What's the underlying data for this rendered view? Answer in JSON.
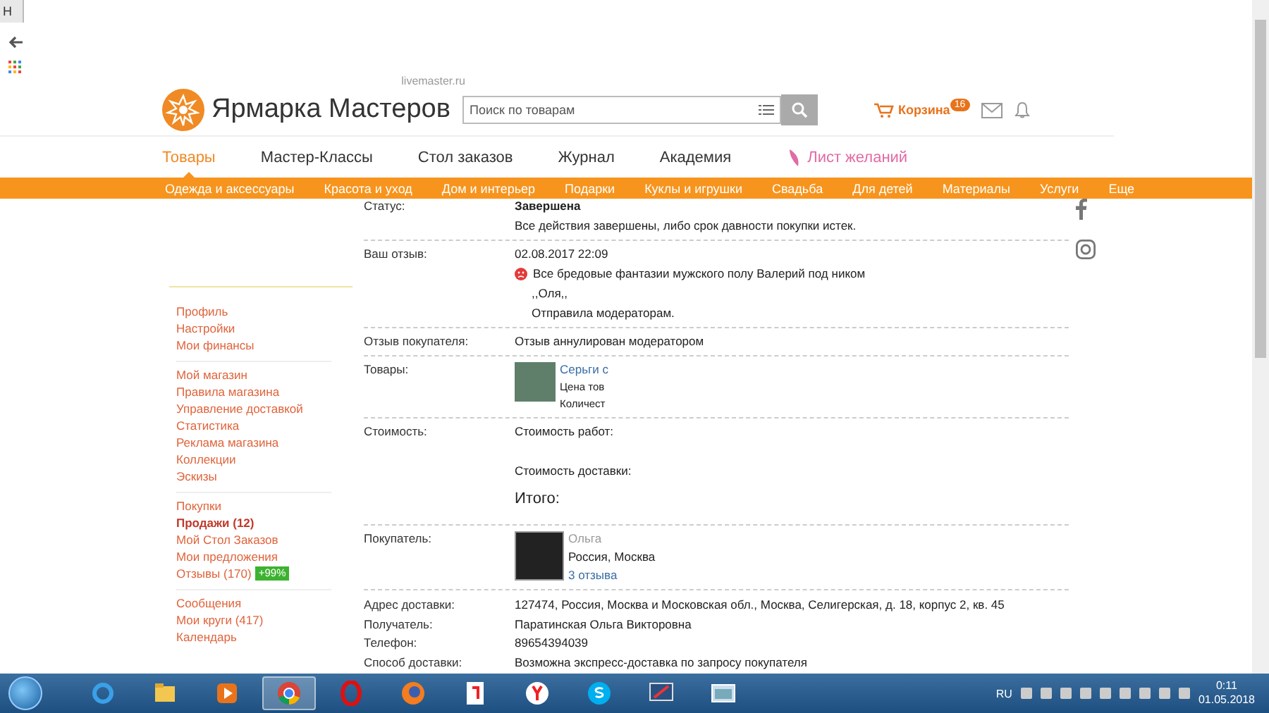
{
  "browser": {
    "tab_title": "Н"
  },
  "header": {
    "logo_text": "Ярмарка Мастеров",
    "logo_domain": "livemaster.ru",
    "search": {
      "placeholder": "Поиск по товарам"
    },
    "cart": {
      "label": "Корзина",
      "count": "16"
    }
  },
  "main_nav": [
    {
      "kind": "tab",
      "label": "Товары",
      "selected": true
    },
    {
      "kind": "tab",
      "label": "Мастер-Классы",
      "selected": false
    },
    {
      "kind": "tab",
      "label": "Стол заказов",
      "selected": false
    },
    {
      "kind": "tab",
      "label": "Журнал",
      "selected": false
    },
    {
      "kind": "tab",
      "label": "Академия",
      "selected": false
    },
    {
      "kind": "wishlist",
      "label": "Лист желаний",
      "selected": false
    }
  ],
  "categories": [
    "Одежда и аксессуары",
    "Красота и уход",
    "Дом и интерьер",
    "Подарки",
    "Куклы и игрушки",
    "Свадьба",
    "Для детей",
    "Материалы",
    "Услуги",
    "Еще"
  ],
  "sidebar": {
    "groups": [
      [
        {
          "label": "Профиль",
          "selected": false
        },
        {
          "label": "Настройки",
          "selected": false
        },
        {
          "label": "Мои финансы",
          "selected": false
        }
      ],
      [
        {
          "label": "Мой магазин",
          "selected": false
        },
        {
          "label": "Правила магазина",
          "selected": false
        },
        {
          "label": "Управление доставкой",
          "selected": false
        },
        {
          "label": "Статистика",
          "selected": false
        },
        {
          "label": "Реклама магазина",
          "selected": false
        },
        {
          "label": "Коллекции",
          "selected": false
        },
        {
          "label": "Эскизы",
          "selected": false
        }
      ],
      [
        {
          "label": "Покупки",
          "selected": false
        },
        {
          "label": "Продажи (12)",
          "selected": true
        },
        {
          "label": "Мой Стол Заказов",
          "selected": false
        },
        {
          "label": "Мои предложения",
          "selected": false
        },
        {
          "label": "Отзывы (170)",
          "selected": false,
          "badge": "+99%"
        }
      ],
      [
        {
          "label": "Сообщения",
          "selected": false
        },
        {
          "label": "Мои круги (417)",
          "selected": false
        },
        {
          "label": "Календарь",
          "selected": false
        }
      ]
    ]
  },
  "details": [
    {
      "kind": "status",
      "label": "Статус:",
      "value": "Завершена",
      "note": "Все действия завершены, либо срок давности покупки истек."
    },
    {
      "kind": "review",
      "label": "Ваш отзыв:",
      "date": "02.08.2017 22:09",
      "lines": [
        "Все бредовые фантазии мужского полу Валерий под ником",
        ",,Оля,,",
        "Отправила модераторам."
      ]
    },
    {
      "kind": "text",
      "label": "Отзыв покупателя:",
      "value": "Отзыв аннулирован модератором"
    },
    {
      "kind": "product",
      "label": "Товары:",
      "title": "Серьги с",
      "lines": [
        "Цена тов",
        "Количест"
      ]
    },
    {
      "kind": "cost",
      "label": "Стоимость:",
      "items": [
        "Стоимость работ:",
        "Стоимость доставки:"
      ],
      "total": "Итого:"
    },
    {
      "kind": "buyer",
      "label": "Покупатель:",
      "name": "Ольга",
      "city": "Россия, Москва",
      "reviews": "3 отзыва"
    }
  ],
  "delivery": [
    {
      "label": "Адрес доставки:",
      "value": "127474, Россия, Москва и Московская обл., Москва, Селигерская, д. 18, корпус 2, кв. 45"
    },
    {
      "label": "Получатель:",
      "value": "Паратинская Ольга Викторовна"
    },
    {
      "label": "Телефон:",
      "value": "89654394039"
    },
    {
      "label": "Способ доставки:",
      "value": "Возможна экспресс-доставка по запросу покупателя"
    }
  ],
  "taskbar": {
    "apps": [
      {
        "kind": "ie",
        "selected": false
      },
      {
        "kind": "explorer",
        "selected": false
      },
      {
        "kind": "media",
        "selected": false
      },
      {
        "kind": "chrome",
        "selected": true
      },
      {
        "kind": "opera",
        "selected": false
      },
      {
        "kind": "firefox",
        "selected": false
      },
      {
        "kind": "yandex-doc",
        "selected": false
      },
      {
        "kind": "yandex",
        "selected": false
      },
      {
        "kind": "skype",
        "selected": false
      },
      {
        "kind": "paint",
        "selected": false
      },
      {
        "kind": "window",
        "selected": false
      }
    ],
    "language": "RU",
    "time": "0:11",
    "date": "01.05.2018"
  }
}
